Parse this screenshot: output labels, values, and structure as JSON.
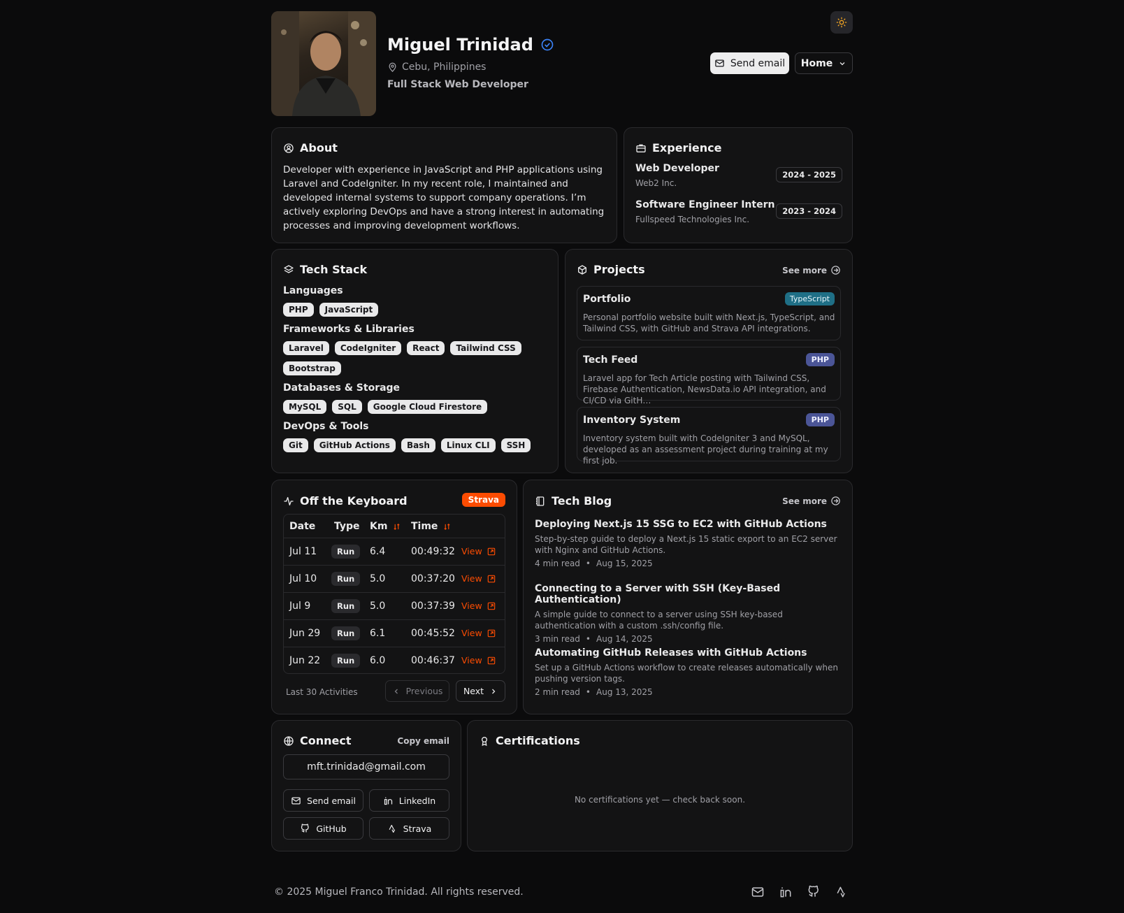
{
  "profile": {
    "name": "Miguel Trinidad",
    "location": "Cebu, Philippines",
    "role": "Full Stack Web Developer"
  },
  "header": {
    "send_email": "Send email",
    "nav_select": "Home"
  },
  "about": {
    "title": "About",
    "text": "Developer with experience in JavaScript and PHP applications using Laravel and CodeIgniter. In my recent role, I maintained and developed internal systems to support company operations. I’m actively exploring DevOps and have a strong interest in automating processes and improving development workflows."
  },
  "experience": {
    "title": "Experience",
    "items": [
      {
        "role": "Web Developer",
        "company": "Web2 Inc.",
        "years": "2024 - 2025"
      },
      {
        "role": "Software Engineer Intern",
        "company": "Fullspeed Technologies Inc.",
        "years": "2023 - 2024"
      }
    ]
  },
  "tech_stack": {
    "title": "Tech Stack",
    "groups": [
      {
        "name": "Languages",
        "items": [
          "PHP",
          "JavaScript"
        ]
      },
      {
        "name": "Frameworks & Libraries",
        "items": [
          "Laravel",
          "CodeIgniter",
          "React",
          "Tailwind CSS",
          "Bootstrap"
        ]
      },
      {
        "name": "Databases & Storage",
        "items": [
          "MySQL",
          "SQL",
          "Google Cloud Firestore"
        ]
      },
      {
        "name": "DevOps & Tools",
        "items": [
          "Git",
          "GitHub Actions",
          "Bash",
          "Linux CLI",
          "SSH"
        ]
      }
    ]
  },
  "projects": {
    "title": "Projects",
    "see_more": "See more",
    "items": [
      {
        "name": "Portfolio",
        "badge": "TypeScript",
        "badge_color": "#1f6f86",
        "desc": "Personal portfolio website built with Next.js, TypeScript, and Tailwind CSS, with GitHub and Strava API integrations."
      },
      {
        "name": "Tech Feed",
        "badge": "PHP",
        "badge_color": "#4b5597",
        "desc": "Laravel app for Tech Article posting with Tailwind CSS, Firebase Authentication, NewsData.io API integration, and CI/CD via GitH…"
      },
      {
        "name": "Inventory System",
        "badge": "PHP",
        "badge_color": "#4b5597",
        "desc": "Inventory system built with CodeIgniter 3 and MySQL, developed as an assessment project during training at my first job."
      }
    ]
  },
  "keyboard": {
    "title": "Off the Keyboard",
    "badge": "Strava",
    "accent": "#fc4c02",
    "columns": {
      "date": "Date",
      "type": "Type",
      "km": "Km",
      "time": "Time"
    },
    "rows": [
      {
        "date": "Jul 11",
        "type": "Run",
        "km": "6.4",
        "time": "00:49:32",
        "link": "View"
      },
      {
        "date": "Jul 10",
        "type": "Run",
        "km": "5.0",
        "time": "00:37:20",
        "link": "View"
      },
      {
        "date": "Jul 9",
        "type": "Run",
        "km": "5.0",
        "time": "00:37:39",
        "link": "View"
      },
      {
        "date": "Jun 29",
        "type": "Run",
        "km": "6.1",
        "time": "00:45:52",
        "link": "View"
      },
      {
        "date": "Jun 22",
        "type": "Run",
        "km": "6.0",
        "time": "00:46:37",
        "link": "View"
      }
    ],
    "footer_note": "Last 30 Activities",
    "prev": "Previous",
    "next": "Next"
  },
  "blog": {
    "title": "Tech Blog",
    "see_more": "See more",
    "posts": [
      {
        "title": "Deploying Next.js 15 SSG to EC2 with GitHub Actions",
        "desc": "Step-by-step guide to deploy a Next.js 15 static export to an EC2 server with Nginx and GitHub Actions.",
        "read": "4 min read",
        "date": "Aug 15, 2025"
      },
      {
        "title": "Connecting to a Server with SSH (Key-Based Authentication)",
        "desc": "A simple guide to connect to a server using SSH key-based authentication with a custom .ssh/config file.",
        "read": "3 min read",
        "date": "Aug 14, 2025"
      },
      {
        "title": "Automating GitHub Releases with GitHub Actions",
        "desc": "Set up a GitHub Actions workflow to create releases automatically when pushing version tags.",
        "read": "2 min read",
        "date": "Aug 13, 2025"
      }
    ]
  },
  "connect": {
    "title": "Connect",
    "copy": "Copy email",
    "email": "mft.trinidad@gmail.com",
    "send_email": "Send email",
    "linkedin": "LinkedIn",
    "github": "GitHub",
    "strava": "Strava"
  },
  "certifications": {
    "title": "Certifications",
    "empty": "No certifications yet — check back soon."
  },
  "footer": {
    "copyright": "© 2025 Miguel Franco Trinidad. All rights reserved."
  }
}
